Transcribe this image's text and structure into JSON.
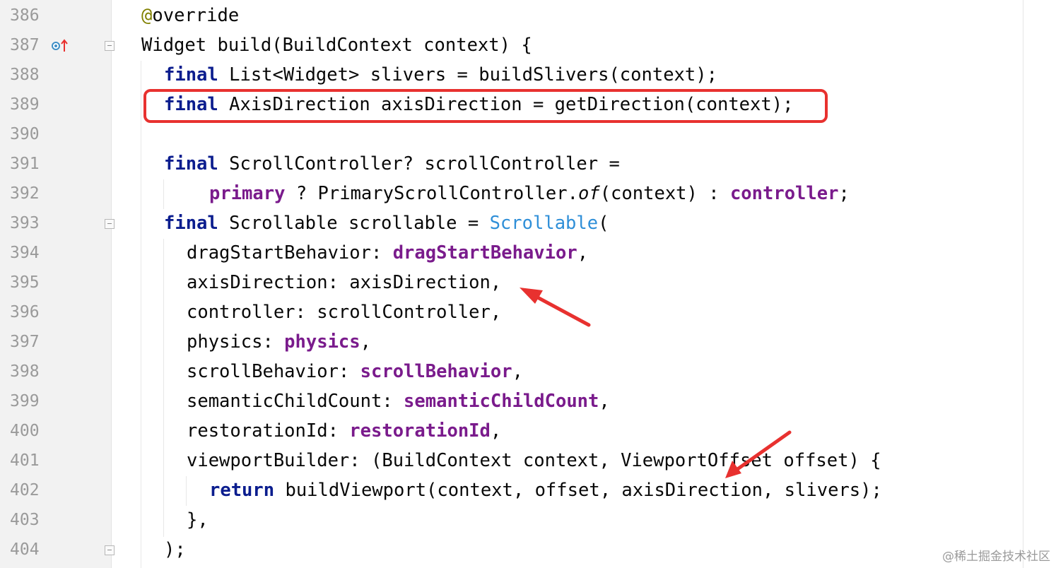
{
  "editor": {
    "line_numbers": [
      "386",
      "387",
      "388",
      "389",
      "390",
      "391",
      "392",
      "393",
      "394",
      "395",
      "396",
      "397",
      "398",
      "399",
      "400",
      "401",
      "402",
      "403",
      "404"
    ],
    "lines": {
      "l386": {
        "a": "@",
        "b": "override"
      },
      "l387": {
        "a": "Widget build(BuildContext context) {"
      },
      "l388": {
        "kw": "final",
        "a": " List<Widget> slivers = buildSlivers(context);"
      },
      "l389": {
        "kw": "final",
        "a": " AxisDirection axisDirection = getDirection(context);"
      },
      "l391": {
        "kw": "final",
        "a": " ScrollController? scrollController ="
      },
      "l392": {
        "f1": "primary",
        "a": " ? PrimaryScrollController.",
        "it": "of",
        "b": "(context) : ",
        "f2": "controller",
        "c": ";"
      },
      "l393": {
        "kw": "final",
        "a": " Scrollable scrollable = ",
        "cls": "Scrollable",
        "b": "("
      },
      "l394": {
        "a": "dragStartBehavior: ",
        "f": "dragStartBehavior",
        "b": ","
      },
      "l395": {
        "a": "axisDirection: axisDirection,"
      },
      "l396": {
        "a": "controller: scrollController,"
      },
      "l397": {
        "a": "physics: ",
        "f": "physics",
        "b": ","
      },
      "l398": {
        "a": "scrollBehavior: ",
        "f": "scrollBehavior",
        "b": ","
      },
      "l399": {
        "a": "semanticChildCount: ",
        "f": "semanticChildCount",
        "b": ","
      },
      "l400": {
        "a": "restorationId: ",
        "f": "restorationId",
        "b": ","
      },
      "l401": {
        "a": "viewportBuilder: (BuildContext context, ViewportOffset offset) {"
      },
      "l402": {
        "kw": "return",
        "a": " buildViewport(context, offset, axisDirection, slivers);"
      },
      "l403": {
        "a": "},"
      },
      "l404": {
        "a": ");"
      }
    }
  },
  "icons": {
    "override_marker": "override-up-arrow-icon",
    "fold_marker": "fold-marker-icon"
  },
  "colors": {
    "keyword": "#0b1d8e",
    "field": "#7a1b8c",
    "class_ref": "#2f8fd8",
    "annotation": "#808000",
    "highlight_box": "#e8312f"
  },
  "watermark": "@稀土掘金技术社区"
}
